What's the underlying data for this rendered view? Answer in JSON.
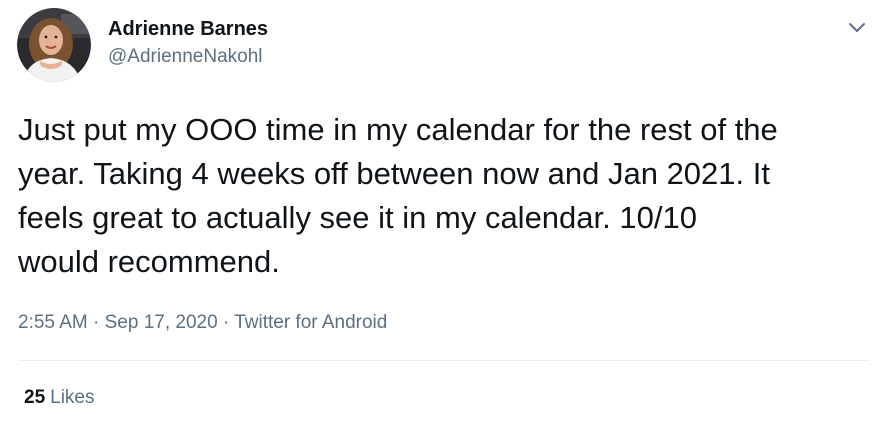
{
  "author": {
    "display_name": "Adrienne Barnes",
    "handle": "@AdrienneNakohl"
  },
  "tweet": {
    "text": "Just put my OOO time in my calendar for the rest of the\nyear. Taking 4 weeks off between now and Jan 2021. It\nfeels great to actually see it in my calendar. 10/10\nwould recommend."
  },
  "meta": {
    "time": "2:55 AM",
    "separator_1": " · ",
    "date": "Sep 17, 2020",
    "separator_2": " · ",
    "source": "Twitter for Android"
  },
  "stats": {
    "likes_count": "25",
    "likes_label": "Likes"
  },
  "icons": {
    "more": "chevron-down-icon"
  },
  "colors": {
    "text_primary": "#0f1419",
    "text_secondary": "#5b7083",
    "divider": "#e6ecf0"
  }
}
